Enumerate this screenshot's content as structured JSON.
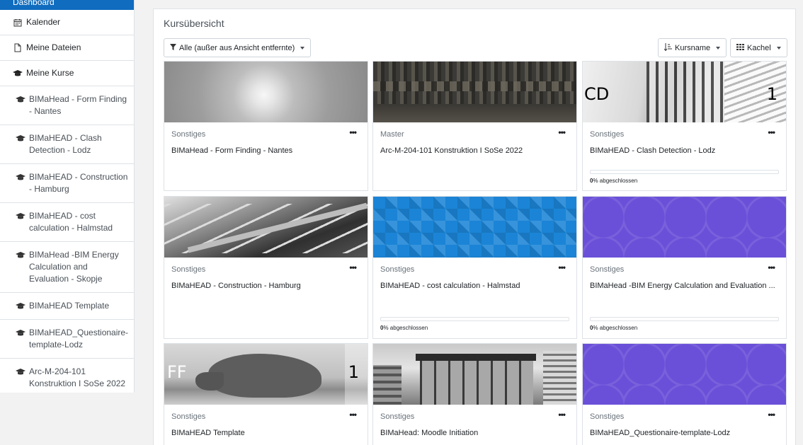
{
  "sidebar": {
    "items": [
      {
        "label": "Dashboard",
        "icon": "dashboard-icon"
      },
      {
        "label": "Kalender",
        "icon": "calendar-icon"
      },
      {
        "label": "Meine Dateien",
        "icon": "file-icon"
      },
      {
        "label": "Meine Kurse",
        "icon": "graduation-cap-icon"
      },
      {
        "label": "BIMaHead - Form Finding - Nantes",
        "icon": "graduation-cap-icon"
      },
      {
        "label": "BIMaHEAD - Clash Detection - Lodz",
        "icon": "graduation-cap-icon"
      },
      {
        "label": "BIMaHEAD - Construction - Hamburg",
        "icon": "graduation-cap-icon"
      },
      {
        "label": "BIMaHEAD - cost calculation - Halmstad",
        "icon": "graduation-cap-icon"
      },
      {
        "label": "BIMaHead -BIM Energy Calculation and Evaluation - Skopje",
        "icon": "graduation-cap-icon"
      },
      {
        "label": "BIMaHEAD Template",
        "icon": "graduation-cap-icon"
      },
      {
        "label": "BIMaHEAD_Questionaire-template-Lodz",
        "icon": "graduation-cap-icon"
      },
      {
        "label": "Arc-M-204-101 Konstruktion I SoSe 2022",
        "icon": "graduation-cap-icon"
      }
    ]
  },
  "overview": {
    "title": "Kursübersicht",
    "filter_label": "Alle (außer aus Ansicht entfernte)",
    "sort_label": "Kursname",
    "view_label": "Kachel"
  },
  "courses": [
    {
      "category": "Sonstiges",
      "name": "BIMaHead - Form Finding - Nantes",
      "image": "sky-photo"
    },
    {
      "category": "Master",
      "name": "Arc-M-204-101 Konstruktion I SoSe 2022",
      "image": "stone-ornament-photo"
    },
    {
      "category": "Sonstiges",
      "name": "BIMaHEAD - Clash Detection - Lodz",
      "image": "pipes-photo",
      "overlay_left": "CD",
      "overlay_right": "1",
      "progress_percent": "0",
      "progress_text": "% abgeschlossen"
    },
    {
      "category": "Sonstiges",
      "name": "BIMaHEAD - Construction - Hamburg",
      "image": "staircase-photo"
    },
    {
      "category": "Sonstiges",
      "name": "BIMaHEAD - cost calculation - Halmstad",
      "image": "blue-diamond-pattern",
      "progress_percent": "0",
      "progress_text": "% abgeschlossen"
    },
    {
      "category": "Sonstiges",
      "name": "BIMaHead -BIM Energy Calculation and Evaluation ...",
      "image": "purple-circle-pattern",
      "progress_percent": "0",
      "progress_text": "% abgeschlossen"
    },
    {
      "category": "Sonstiges",
      "name": "BIMaHEAD Template",
      "image": "rhino-photo",
      "overlay_left": "FF",
      "overlay_right": "1"
    },
    {
      "category": "Sonstiges",
      "name": "BIMaHead: Moodle Initiation",
      "image": "building-photo"
    },
    {
      "category": "Sonstiges",
      "name": "BIMaHEAD_Questionaire-template-Lodz",
      "image": "purple-circle-pattern"
    }
  ],
  "colors": {
    "accent": "#0f6cbf",
    "blue_pattern": "#1b84d6",
    "purple_pattern": "#6a4fd8"
  }
}
